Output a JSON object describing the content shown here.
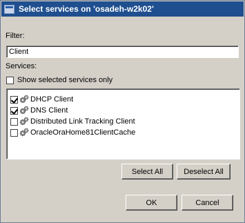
{
  "window": {
    "title": "Select services on 'osadeh-w2k02'"
  },
  "filter": {
    "label": "Filter:",
    "value": "Client"
  },
  "services": {
    "label": "Services:",
    "show_selected_label": "Show selected services only",
    "show_selected_checked": false,
    "items": [
      {
        "label": "DHCP Client",
        "checked": true,
        "icon": "gear-icon"
      },
      {
        "label": "DNS Client",
        "checked": true,
        "icon": "gear-icon"
      },
      {
        "label": "Distributed Link Tracking Client",
        "checked": false,
        "icon": "gear-icon"
      },
      {
        "label": "OracleOraHome81ClientCache",
        "checked": false,
        "icon": "gear-icon"
      }
    ]
  },
  "buttons": {
    "select_all": "Select All",
    "deselect_all": "Deselect All",
    "ok": "OK",
    "cancel": "Cancel"
  },
  "colors": {
    "titlebar": "#1f4f8f",
    "dialog_bg": "#d4d0c8"
  }
}
